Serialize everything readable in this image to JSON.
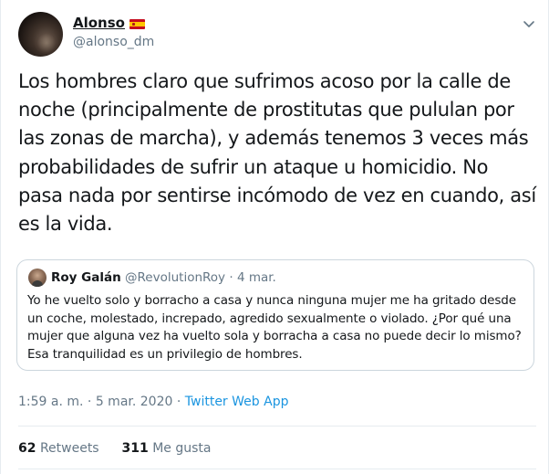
{
  "tweet": {
    "author_name": "Alonso",
    "author_flag": "spain-flag-icon",
    "author_handle": "@alonso_dm",
    "text": "Los hombres claro que sufrimos acoso por la calle de noche (principalmente de prostitutas que pululan por las zonas de marcha), y además tenemos 3 veces más probabilidades de sufrir un ataque u homicidio. No pasa nada por sentirse incómodo de vez en cuando, así es la vida.",
    "time": "1:59 a. m.",
    "separator": "·",
    "date": "5 mar. 2020",
    "source": "Twitter Web App",
    "retweets_count": "62",
    "retweets_label": "Retweets",
    "likes_count": "311",
    "likes_label": "Me gusta"
  },
  "quoted_tweet": {
    "author_name": "Roy Galán",
    "author_handle": "@RevolutionRoy",
    "separator": "·",
    "date": "4 mar.",
    "text": "Yo he vuelto solo y borracho a casa y nunca ninguna mujer me ha gritado desde un coche, molestado, increpado, agredido sexualmente o violado. ¿Por qué una mujer que alguna vez ha vuelto sola y borracha a casa no puede decir lo mismo? Esa tranquilidad es un privilegio de hombres."
  },
  "colors": {
    "text_primary": "#14171a",
    "text_secondary": "#657786",
    "link": "#1b95e0",
    "border": "#ccd6dd",
    "divider": "#e6ecf0"
  },
  "icons": {
    "caret": "chevron-down-icon"
  }
}
